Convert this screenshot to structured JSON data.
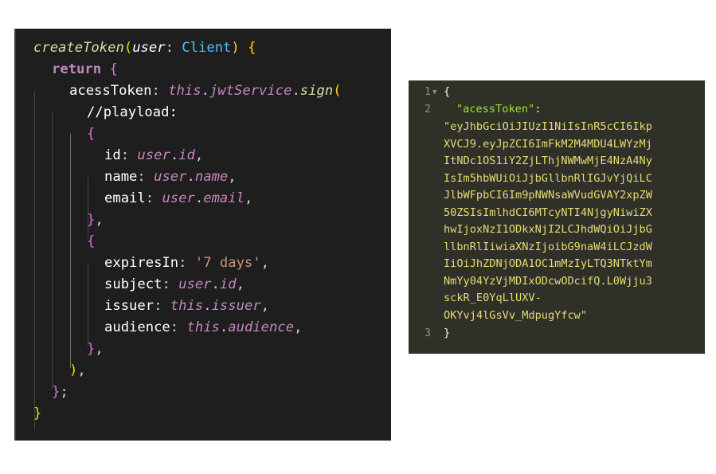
{
  "editor": {
    "line1": {
      "fn": "createToken",
      "open": "(",
      "param": "user",
      "colon": ": ",
      "type": "Client",
      "close": ")",
      "space": " ",
      "brace": "{"
    },
    "line2": {
      "kw": "return",
      "space": " ",
      "brace": "{"
    },
    "line3": {
      "prop": "acessToken",
      "colon": ": ",
      "this": "this",
      "dot1": ".",
      "service": "jwtService",
      "dot2": ".",
      "method": "sign",
      "paren": "("
    },
    "line4": {
      "comment": "//playload:"
    },
    "line5": {
      "brace": "{"
    },
    "line6": {
      "prop": "id",
      "colon": ": ",
      "obj": "user",
      "dot": ".",
      "member": "id",
      "comma": ","
    },
    "line7": {
      "prop": "name",
      "colon": ": ",
      "obj": "user",
      "dot": ".",
      "member": "name",
      "comma": ","
    },
    "line8": {
      "prop": "email",
      "colon": ": ",
      "obj": "user",
      "dot": ".",
      "member": "email",
      "comma": ","
    },
    "line9": {
      "brace": "}",
      "comma": ","
    },
    "line10": {
      "brace": "{"
    },
    "line11": {
      "prop": "expiresIn",
      "colon": ": ",
      "str": "'7 days'",
      "comma": ","
    },
    "line12": {
      "prop": "subject",
      "colon": ": ",
      "obj": "user",
      "dot": ".",
      "member": "id",
      "comma": ","
    },
    "line13": {
      "prop": "issuer",
      "colon": ": ",
      "obj": "this",
      "dot": ".",
      "member": "issuer",
      "comma": ","
    },
    "line14": {
      "prop": "audience",
      "colon": ": ",
      "obj": "this",
      "dot": ".",
      "member": "audience",
      "comma": ","
    },
    "line15": {
      "brace": "}",
      "comma": ","
    },
    "line16": {
      "paren": ")",
      "comma": ","
    },
    "line17": {
      "brace": "}",
      "semi": ";"
    },
    "line18": {
      "brace": "}"
    }
  },
  "json_viewer": {
    "gutter": [
      "1",
      "2",
      "3"
    ],
    "open_brace": "{",
    "key": "\"acessToken\"",
    "colon": ":",
    "value_lines": [
      "\"eyJhbGciOiJIUzI1NiIsInR5cCI6Ikp",
      "XVCJ9.eyJpZCI6ImFkM2M4MDU4LWYzMj",
      "ItNDc1OS1iY2ZjLThjNWMwMjE4NzA4Ny",
      "IsIm5hbWUiOiJjbGllbnRlIGJvYjQiLC",
      "JlbWFpbCI6Im9pNWNsaWVudGVAY2xpZW",
      "50ZSIsImlhdCI6MTcyNTI4NjgyNiwiZX",
      "hwIjoxNzI1ODkxNjI2LCJhdWQiOiJjbG",
      "llbnRlIiwiaXNzIjoibG9naW4iLCJzdW",
      "IiOiJhZDNjODA1OC1mMzIyLTQ3NTktYm",
      "NmYy04YzVjMDIxODcwODcifQ.L0Wjju3",
      "sckR_E0YqLlUXV-",
      "OKYvj4lGsVv_MdpugYfcw\""
    ],
    "close_brace": "}"
  }
}
